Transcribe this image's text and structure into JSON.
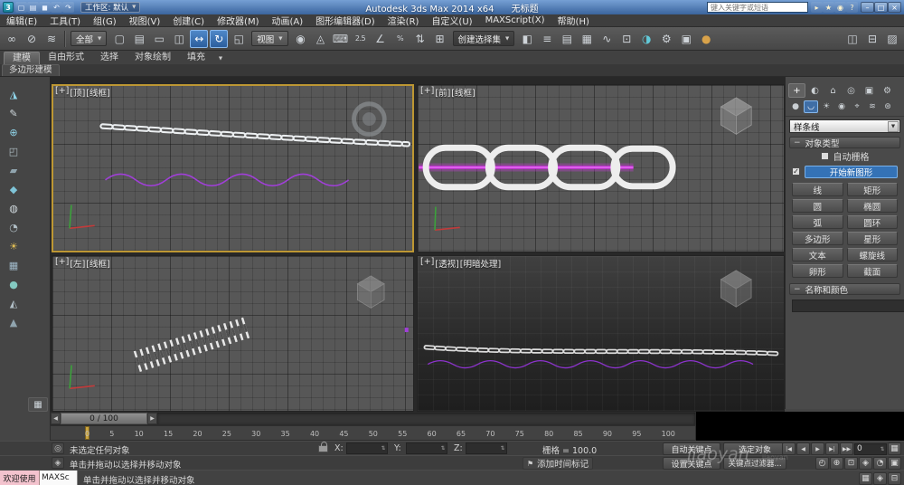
{
  "glyphs": {
    "dropdown": "▼",
    "collapse": "−",
    "check": "✓",
    "flag": "⚑",
    "clock": "◴",
    "spinner": "⇅",
    "left_arrow": "◀",
    "right_arrow": "▶"
  },
  "title_bar": {
    "logo": "3",
    "app_title": "Autodesk 3ds Max  2014 x64",
    "doc_title": "无标题",
    "workspace": "工作区: 默认",
    "search_placeholder": "键入关键字或短语",
    "qat_icons": [
      {
        "n": "new-scene-icon",
        "g": "▢"
      },
      {
        "n": "open-file-icon",
        "g": "▤"
      },
      {
        "n": "save-file-icon",
        "g": "◼"
      },
      {
        "n": "undo-icon",
        "g": "↶"
      },
      {
        "n": "redo-icon",
        "g": "↷"
      }
    ],
    "info_icons": [
      {
        "n": "search-go-icon",
        "g": "▸"
      },
      {
        "n": "infocenter-star-icon",
        "g": "★"
      },
      {
        "n": "communication-center-icon",
        "g": "◉"
      },
      {
        "n": "help-icon",
        "g": "?"
      }
    ],
    "window_buttons": [
      {
        "n": "minimize-button",
        "g": "–"
      },
      {
        "n": "restore-button",
        "g": "□"
      },
      {
        "n": "close-button",
        "g": "×"
      }
    ]
  },
  "menus": [
    "编辑(E)",
    "工具(T)",
    "组(G)",
    "视图(V)",
    "创建(C)",
    "修改器(M)",
    "动画(A)",
    "图形编辑器(D)",
    "渲染(R)",
    "自定义(U)",
    "MAXScript(X)",
    "帮助(H)"
  ],
  "main_toolbar": {
    "filter_value": "全部",
    "coord_value": "视图",
    "named_sel_value": "创建选择集",
    "icons_a": [
      {
        "n": "select-and-link-icon",
        "g": "∞"
      },
      {
        "n": "unlink-selection-icon",
        "g": "⊘"
      },
      {
        "n": "bind-to-space-warp-icon",
        "g": "≋"
      }
    ],
    "icons_b": [
      {
        "n": "select-object-icon",
        "g": "▢"
      },
      {
        "n": "select-by-name-icon",
        "g": "▤"
      },
      {
        "n": "rectangular-selection-region-icon",
        "g": "▭"
      },
      {
        "n": "window-crossing-icon",
        "g": "◫"
      },
      {
        "n": "select-and-move-icon",
        "g": "↔",
        "cls": "hl"
      },
      {
        "n": "select-and-rotate-icon",
        "g": "↻",
        "cls": "hl"
      },
      {
        "n": "select-and-scale-icon",
        "g": "◱"
      }
    ],
    "icons_c": [
      {
        "n": "use-pivot-point-icon",
        "g": "◉"
      },
      {
        "n": "select-and-manipulate-icon",
        "g": "◬"
      },
      {
        "n": "keyboard-shortcut-override-icon",
        "g": "⌨"
      },
      {
        "n": "snaps-toggle-icon",
        "g": "2.5",
        "cls": "txt"
      },
      {
        "n": "angle-snap-icon",
        "g": "∠"
      },
      {
        "n": "percent-snap-icon",
        "g": "%",
        "cls": "txt"
      },
      {
        "n": "spinner-snap-icon",
        "g": "⇅"
      },
      {
        "n": "edit-named-selection-sets-icon",
        "g": "⊞"
      }
    ],
    "icons_d": [
      {
        "n": "mirror-icon",
        "g": "◧"
      },
      {
        "n": "align-icon",
        "g": "≡"
      },
      {
        "n": "layer-manager-icon",
        "g": "▤"
      },
      {
        "n": "graphite-ribbon-toggle-icon",
        "g": "▦"
      },
      {
        "n": "curve-editor-icon",
        "g": "∿"
      },
      {
        "n": "schematic-view-icon",
        "g": "⊡"
      },
      {
        "n": "material-editor-icon",
        "g": "◑",
        "s": "color:#62c9d8"
      },
      {
        "n": "render-setup-icon",
        "g": "⚙"
      },
      {
        "n": "rendered-frame-window-icon",
        "g": "▣"
      },
      {
        "n": "render-production-icon",
        "g": "●",
        "s": "color:#d8a24a"
      }
    ],
    "icons_e": [
      {
        "n": "toolbar-extra-icon-1",
        "g": "◫"
      },
      {
        "n": "toolbar-extra-icon-2",
        "g": "⊟"
      },
      {
        "n": "toolbar-extra-icon-3",
        "g": "▨"
      }
    ]
  },
  "ribbon": {
    "tabs": [
      {
        "label": "建模",
        "cls": "active"
      },
      {
        "label": "自由形式"
      },
      {
        "label": "选择"
      },
      {
        "label": "对象绘制"
      },
      {
        "label": "填充"
      }
    ],
    "panel_tab": "多边形建模"
  },
  "left_toolbar": [
    {
      "n": "left-tool-icon-1",
      "g": "◮",
      "s": "color:#8fd3e8"
    },
    {
      "n": "left-tool-icon-2",
      "g": "✎",
      "s": "color:#cfd8dc"
    },
    {
      "n": "left-tool-icon-3",
      "g": "⊕",
      "s": "color:#8fd3e8"
    },
    {
      "n": "left-tool-icon-4",
      "g": "◰",
      "s": "color:#b0bec5"
    },
    {
      "n": "left-tool-icon-5",
      "g": "▰",
      "s": "color:#90a4ae"
    },
    {
      "n": "left-tool-icon-6",
      "g": "◆",
      "s": "color:#7fc4d8"
    },
    {
      "n": "left-tool-icon-7",
      "g": "◍",
      "s": "color:#cfd8dc"
    },
    {
      "n": "left-tool-icon-8",
      "g": "◔",
      "s": "color:#b0bec5"
    },
    {
      "n": "left-tool-icon-9",
      "g": "☀",
      "s": "color:#e0bd55"
    },
    {
      "n": "left-tool-icon-10",
      "g": "▦",
      "s": "color:#9fb8c8"
    },
    {
      "n": "left-tool-icon-11",
      "g": "●",
      "s": "color:#84c9c1"
    },
    {
      "n": "left-tool-icon-12",
      "g": "◭",
      "s": "color:#b0bec5"
    },
    {
      "n": "left-tool-icon-13",
      "g": "▲",
      "s": "color:#90a4ae"
    }
  ],
  "viewports": {
    "top_left": {
      "plus": "[+]",
      "view": "[顶]",
      "shading": "[线框]"
    },
    "top_right": {
      "plus": "[+]",
      "view": "[前]",
      "shading": "[线框]"
    },
    "bottom_left": {
      "plus": "[+]",
      "view": "[左]",
      "shading": "[线框]"
    },
    "bottom_right": {
      "plus": "[+]",
      "view": "[透视]",
      "shading": "[明暗处理]"
    }
  },
  "command_panel": {
    "tabs": [
      {
        "n": "create-tab-icon",
        "g": "+",
        "cls": "active"
      },
      {
        "n": "modify-tab-icon",
        "g": "◐"
      },
      {
        "n": "hierarchy-tab-icon",
        "g": "⌂"
      },
      {
        "n": "motion-tab-icon",
        "g": "◎"
      },
      {
        "n": "display-tab-icon",
        "g": "▣"
      },
      {
        "n": "utilities-tab-icon",
        "g": "⚙"
      }
    ],
    "categories": [
      {
        "n": "geometry-category-icon",
        "g": "●"
      },
      {
        "n": "shapes-category-icon",
        "g": "◡",
        "cls": "active"
      },
      {
        "n": "lights-category-icon",
        "g": "☀"
      },
      {
        "n": "cameras-category-icon",
        "g": "◉"
      },
      {
        "n": "helpers-category-icon",
        "g": "⌖"
      },
      {
        "n": "space-warps-category-icon",
        "g": "≋"
      },
      {
        "n": "systems-category-icon",
        "g": "⊛"
      }
    ],
    "type_dropdown": "样条线",
    "rollout_object_type": "对象类型",
    "autogrid_label": "自动栅格",
    "start_new_shape_label": "开始新图形",
    "shape_buttons": [
      "线",
      "矩形",
      "圆",
      "椭圆",
      "弧",
      "圆环",
      "多边形",
      "星形",
      "文本",
      "螺旋线",
      "卵形",
      "截面"
    ],
    "rollout_name_color": "名称和颜色"
  },
  "timeline": {
    "slider_value": "0 / 100",
    "ticks": [
      "0",
      "5",
      "10",
      "15",
      "20",
      "25",
      "30",
      "35",
      "40",
      "45",
      "50",
      "55",
      "60",
      "65",
      "70",
      "75",
      "80",
      "85",
      "90",
      "95",
      "100"
    ]
  },
  "status": {
    "status_line": "未选定任何对象",
    "prompt_line": "单击并拖动以选择并移动对象",
    "x_label": "X:",
    "y_label": "Y:",
    "z_label": "Z:",
    "grid_label": "栅格 = 100.0",
    "add_time_tag": "添加时间标记",
    "auto_key": "自动关键点",
    "selected_dropdown": "选定对象",
    "set_key": "设置关键点",
    "key_filters": "关键点过滤器...",
    "frame_value": "0",
    "transport": [
      {
        "n": "go-to-start-icon",
        "g": "|◀"
      },
      {
        "n": "previous-frame-icon",
        "g": "◀"
      },
      {
        "n": "play-animation-icon",
        "g": "▶"
      },
      {
        "n": "next-frame-icon",
        "g": "▶|"
      },
      {
        "n": "go-to-end-icon",
        "g": "▶▶"
      }
    ],
    "nav_icons": [
      {
        "n": "zoom-icon",
        "g": "⊕"
      },
      {
        "n": "zoom-extents-all-icon",
        "g": "⊡"
      },
      {
        "n": "pan-view-icon",
        "g": "◈"
      },
      {
        "n": "orbit-icon",
        "g": "◔"
      },
      {
        "n": "maximize-viewport-toggle-icon",
        "g": "▣"
      }
    ],
    "row3_icons": [
      {
        "n": "grid-snap-status-icon",
        "g": "▦"
      },
      {
        "n": "lock-status-icon",
        "g": "◈"
      },
      {
        "n": "dock-status-icon",
        "g": "⊟"
      }
    ]
  },
  "listener": {
    "line1": "欢迎使用",
    "line2": "MAXSc"
  },
  "watermark": {
    "text": "jiaoyan"
  }
}
